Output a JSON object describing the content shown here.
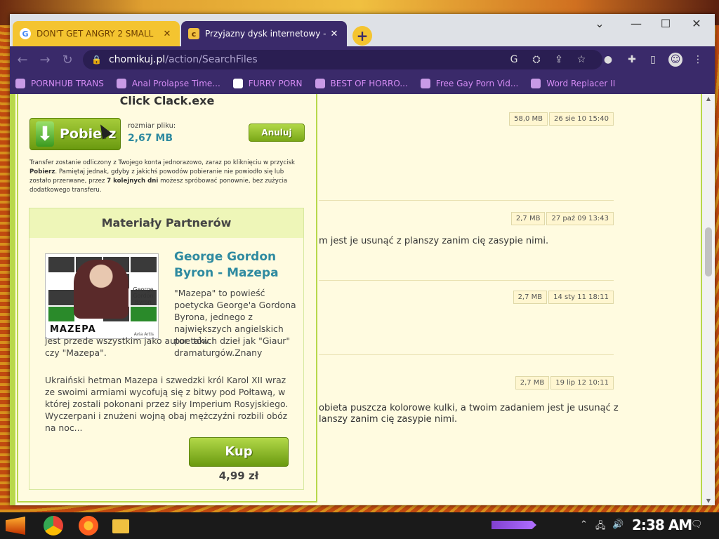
{
  "tabs": [
    {
      "title": "DON'T GET ANGRY 2 SMALL",
      "favicon": "google-icon",
      "active": false
    },
    {
      "title": "Przyjazny dysk internetowy - C",
      "favicon": "chomikuj-icon",
      "active": true
    }
  ],
  "toolbar": {
    "url_domain": "chomikuj.pl",
    "url_path": "/action/SearchFiles"
  },
  "bookmarks": [
    {
      "label": "PORNHUB TRANS"
    },
    {
      "label": "Anal Prolapse Time..."
    },
    {
      "label": "FURRY PORN"
    },
    {
      "label": "BEST OF HORRO..."
    },
    {
      "label": "Free Gay Porn Vid..."
    },
    {
      "label": "Word Replacer II"
    }
  ],
  "results": [
    {
      "size": "58,0 MB",
      "date": "26 sie 10 15:40",
      "desc": ""
    },
    {
      "size": "2,7 MB",
      "date": "27 paź 09 13:43",
      "desc": "m jest je usunąć z planszy zanim cię zasypie nimi."
    },
    {
      "size": "2,7 MB",
      "date": "14 sty 11 18:11",
      "desc": ""
    },
    {
      "size": "2,7 MB",
      "date": "19 lip 12 10:11",
      "desc1": "obieta puszcza kolorowe kulki, a twoim zadaniem jest je usunąć z",
      "desc2": "lanszy zanim cię zasypie nimi."
    }
  ],
  "download": {
    "filename": "Click Clack.exe",
    "pobierz_label": "Pobierz",
    "size_label": "rozmiar pliku:",
    "size_value": "2,67 MB",
    "anuluj_label": "Anuluj",
    "transfer_1": "Transfer zostanie odliczony z Twojego konta jednorazowo, zaraz po kliknięciu w przycisk ",
    "transfer_b1": "Pobierz",
    "transfer_2": ". Pamiętaj jednak, gdyby z jakichś powodów pobieranie nie powiodło się lub zostało przerwane, przez ",
    "transfer_b2": "7 kolejnych dni",
    "transfer_3": " możesz spróbować ponownie, bez zużycia dodatkowego transferu."
  },
  "partners": {
    "heading": "Materiały Partnerów",
    "book_cover_author": "George Gordon Byron",
    "book_cover_title": "MAZEPA",
    "book_cover_publisher": "Avia Artis",
    "book_title": "George Gordon Byron - Mazepa",
    "desc_a": "\"Mazepa\" to powieść poetycka George'a Gordona Byrona, jednego z największych angielskich poe tów i dramaturgów.Znany",
    "desc_b": "jest przede wszystkim jako autor takich dzieł jak \"Giaur\" czy \"Mazepa\".",
    "desc_c": "Ukraiński hetman Mazepa i szwedzki król Karol XII wraz ze swoimi armiami wycofują się z bitwy pod Połtawą, w której zostali pokonani przez siły Imperium Rosyjskiego. Wyczerpani i znużeni wojną obaj mężczyźni rozbili obóz na noc...",
    "buy_label": "Kup",
    "price": "4,99 zł"
  },
  "taskbar": {
    "clock": "2:38 AM"
  },
  "colors": {
    "accent_green": "#7aa818",
    "link_teal": "#2e8aa0",
    "browser_purple": "#3a2a6a",
    "bookmark_pink": "#d58cf5"
  }
}
